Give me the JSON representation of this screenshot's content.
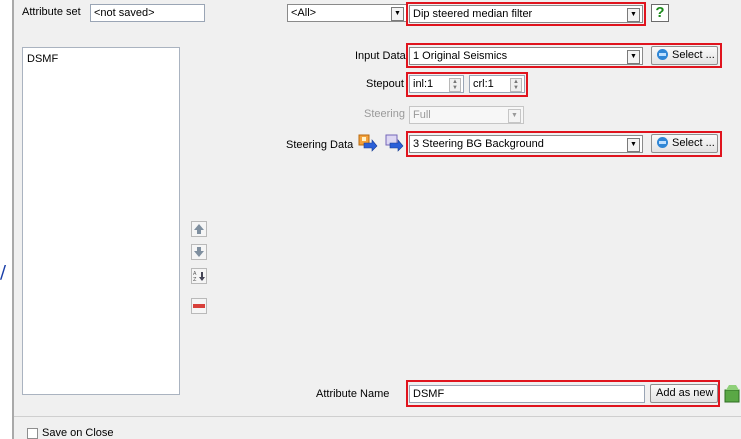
{
  "attribute_set": {
    "label": "Attribute set",
    "value": "<not saved>"
  },
  "category_select": {
    "value": "<All>"
  },
  "method_select": {
    "value": "Dip steered median filter"
  },
  "help_button": {
    "label": "?"
  },
  "attribute_list": {
    "items": [
      "DSMF"
    ]
  },
  "input_data": {
    "label": "Input Data",
    "value": "1 Original Seismics",
    "select_label": "Select ..."
  },
  "stepout": {
    "label": "Stepout",
    "inl": "inl:1",
    "crl": "crl:1"
  },
  "steering": {
    "label": "Steering",
    "value": "Full"
  },
  "steering_data": {
    "label": "Steering Data",
    "value": "3 Steering BG Background",
    "select_label": "Select ..."
  },
  "attribute_name": {
    "label": "Attribute Name",
    "value": "DSMF",
    "add_label": "Add as new"
  },
  "save_on_close": {
    "label": "Save on Close",
    "checked": false
  },
  "colors": {
    "highlight": "#e0141e",
    "dialog_bg": "#f0f0f0",
    "help_green": "#1a8a1a"
  }
}
